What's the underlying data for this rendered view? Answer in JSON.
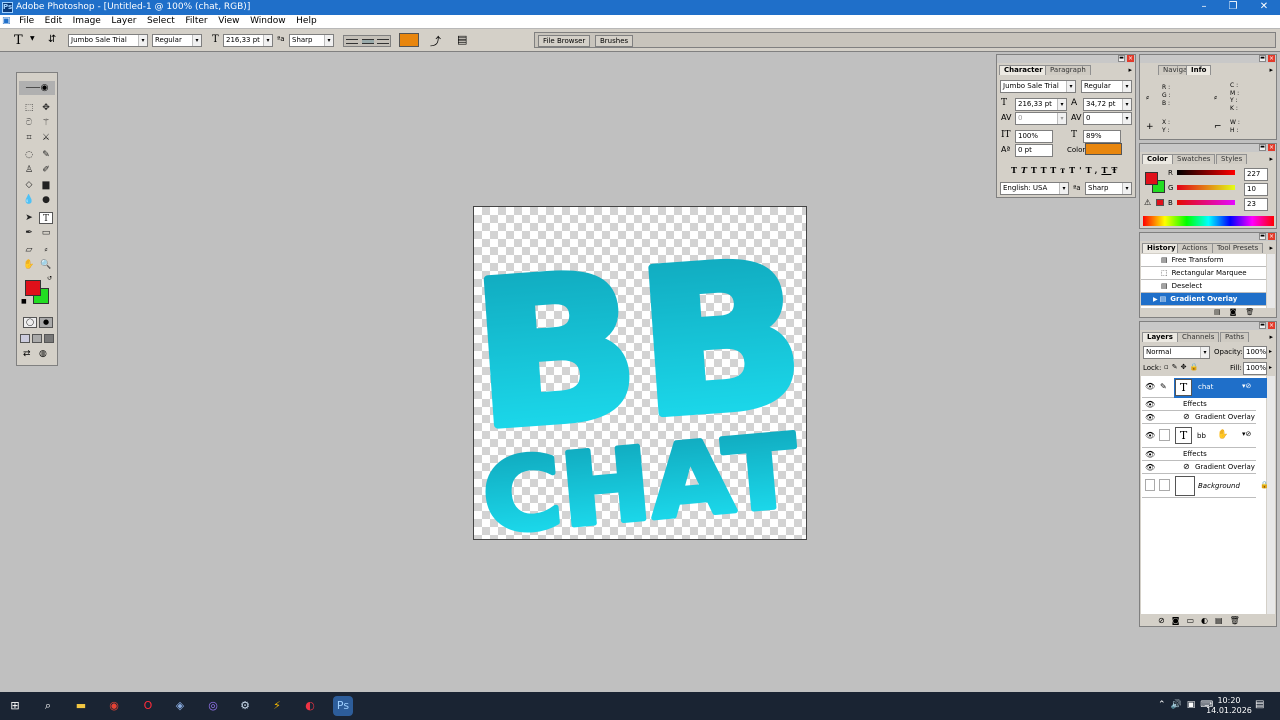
{
  "window": {
    "title": "Adobe Photoshop - [Untitled-1 @ 100% (chat, RGB)]",
    "app_icon": "Ps"
  },
  "menu": [
    "File",
    "Edit",
    "Image",
    "Layer",
    "Select",
    "Filter",
    "View",
    "Window",
    "Help"
  ],
  "options_bar": {
    "tool_icon": "T",
    "font_family": "Jumbo Sale Trial",
    "font_style": "Regular",
    "font_size": "216,33 pt",
    "aa_prefix": "ªa",
    "antialias": "Sharp",
    "color": "#e8860e",
    "tabs": [
      "File Browser",
      "Brushes"
    ]
  },
  "canvas": {
    "line1": "BB",
    "line2": "CHAT",
    "gradient_top": "#0fa3b8",
    "gradient_bottom": "#1ee3f5"
  },
  "character_panel": {
    "tabs": [
      "Character",
      "Paragraph"
    ],
    "font_family": "Jumbo Sale Trial",
    "font_style": "Regular",
    "size": "216,33 pt",
    "leading": "34,72 pt",
    "kerning": "0",
    "tracking": "0",
    "vscale": "100%",
    "hscale": "89%",
    "baseline": "0 pt",
    "color_label": "Color:",
    "color": "#e8860e",
    "style_buttons": [
      "T",
      "T",
      "TT",
      "Tт",
      "T'",
      "T,",
      "T",
      "Ŧ"
    ],
    "language": "English: USA",
    "aa_prefix": "ªa",
    "antialias": "Sharp"
  },
  "info_panel": {
    "tabs": [
      "Navigator",
      "Info"
    ],
    "rgb_labels": [
      "R :",
      "G :",
      "B :"
    ],
    "cmyk_labels": [
      "C :",
      "M :",
      "Y :",
      "K :"
    ],
    "xy_labels": [
      "X :",
      "Y :"
    ],
    "wh_labels": [
      "W :",
      "H :"
    ]
  },
  "color_panel": {
    "tabs": [
      "Color",
      "Swatches",
      "Styles"
    ],
    "channels": [
      {
        "name": "R",
        "value": "227"
      },
      {
        "name": "G",
        "value": "10"
      },
      {
        "name": "B",
        "value": "23"
      }
    ],
    "foreground": "#e0101a",
    "background": "#22dd22"
  },
  "history_panel": {
    "tabs": [
      "History",
      "Actions",
      "Tool Presets"
    ],
    "items": [
      "Free Transform",
      "Rectangular Marquee",
      "Deselect",
      "Gradient Overlay"
    ],
    "selected_index": 3
  },
  "layers_panel": {
    "tabs": [
      "Layers",
      "Channels",
      "Paths"
    ],
    "blend_mode": "Normal",
    "opacity_label": "Opacity:",
    "opacity": "100%",
    "lock_label": "Lock:",
    "fill_label": "Fill:",
    "fill": "100%",
    "layers": [
      {
        "name": "chat",
        "type": "T",
        "selected": true,
        "effects_label": "Effects",
        "effect": "Gradient Overlay"
      },
      {
        "name": "bb",
        "type": "T",
        "selected": false,
        "effects_label": "Effects",
        "effect": "Gradient Overlay"
      },
      {
        "name": "Background",
        "type": "bg",
        "selected": false
      }
    ]
  },
  "toolbox": {
    "foreground": "#e0101a",
    "background": "#22dd22"
  },
  "taskbar": {
    "time": "10:20",
    "date": "14.01.2026"
  }
}
